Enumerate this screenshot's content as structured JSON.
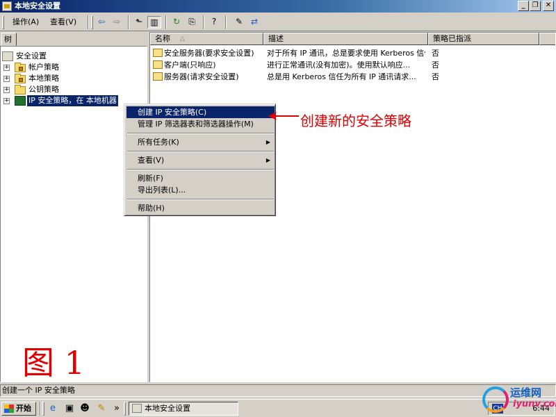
{
  "window": {
    "title": "本地安全设置",
    "minimize": "_",
    "restore": "❐",
    "close": "✕"
  },
  "menubar": {
    "items": [
      "操作(A)",
      "查看(V)"
    ]
  },
  "toolbar": {
    "buttons": [
      "back-icon",
      "forward-icon",
      "up-folder-icon",
      "show-tree-icon",
      "refresh-icon",
      "export-list-icon",
      "help-icon",
      "new-policy-icon",
      "assign-policy-icon"
    ]
  },
  "tree": {
    "tab_label": "树",
    "root": "安全设置",
    "items": [
      {
        "label": "帐户策略",
        "icon": "folder-icon"
      },
      {
        "label": "本地策略",
        "icon": "folder-icon"
      },
      {
        "label": "公钥策略",
        "icon": "folder-icon"
      },
      {
        "label": "IP 安全策略，在 本地机器",
        "icon": "ip-security-icon",
        "selected": true
      }
    ]
  },
  "list": {
    "columns": [
      "名称",
      "描述",
      "策略已指派"
    ],
    "sort_indicator": "△",
    "rows": [
      {
        "name": "安全服务器(要求安全设置)",
        "description": "对于所有 IP 通讯，总是要求使用 Kerberos 信任...",
        "assigned": "否"
      },
      {
        "name": "客户端(只响应)",
        "description": "进行正常通讯(没有加密)。使用默认响应...",
        "assigned": "否"
      },
      {
        "name": "服务器(请求安全设置)",
        "description": "总是用 Kerberos 信任为所有 IP 通讯请求...",
        "assigned": "否"
      }
    ]
  },
  "context_menu": {
    "items": [
      {
        "label": "创建 IP 安全策略(C)",
        "highlighted": true
      },
      {
        "label": "管理 IP 筛选器表和筛选器操作(M)"
      },
      {
        "separator": true
      },
      {
        "label": "所有任务(K)",
        "submenu": true
      },
      {
        "separator": true
      },
      {
        "label": "查看(V)",
        "submenu": true
      },
      {
        "separator": true
      },
      {
        "label": "刷新(F)"
      },
      {
        "label": "导出列表(L)..."
      },
      {
        "separator": true
      },
      {
        "label": "帮助(H)"
      }
    ],
    "submenu_arrow": "▶"
  },
  "annotation": {
    "callout": "创建新的安全策略",
    "figure_label": "图 1",
    "color": "#e00000"
  },
  "statusbar": {
    "text": "创建一个 IP 安全策略"
  },
  "taskbar": {
    "start_label": "开始",
    "quick_launch": [
      "ie-icon",
      "desktop-icon",
      "qq-icon",
      "pencil-icon"
    ],
    "overflow": "»",
    "task_label": "本地安全设置",
    "ime": "CH",
    "clock": "6:44"
  },
  "watermark": {
    "text1": "运维网",
    "text2": "iyunv.com"
  }
}
